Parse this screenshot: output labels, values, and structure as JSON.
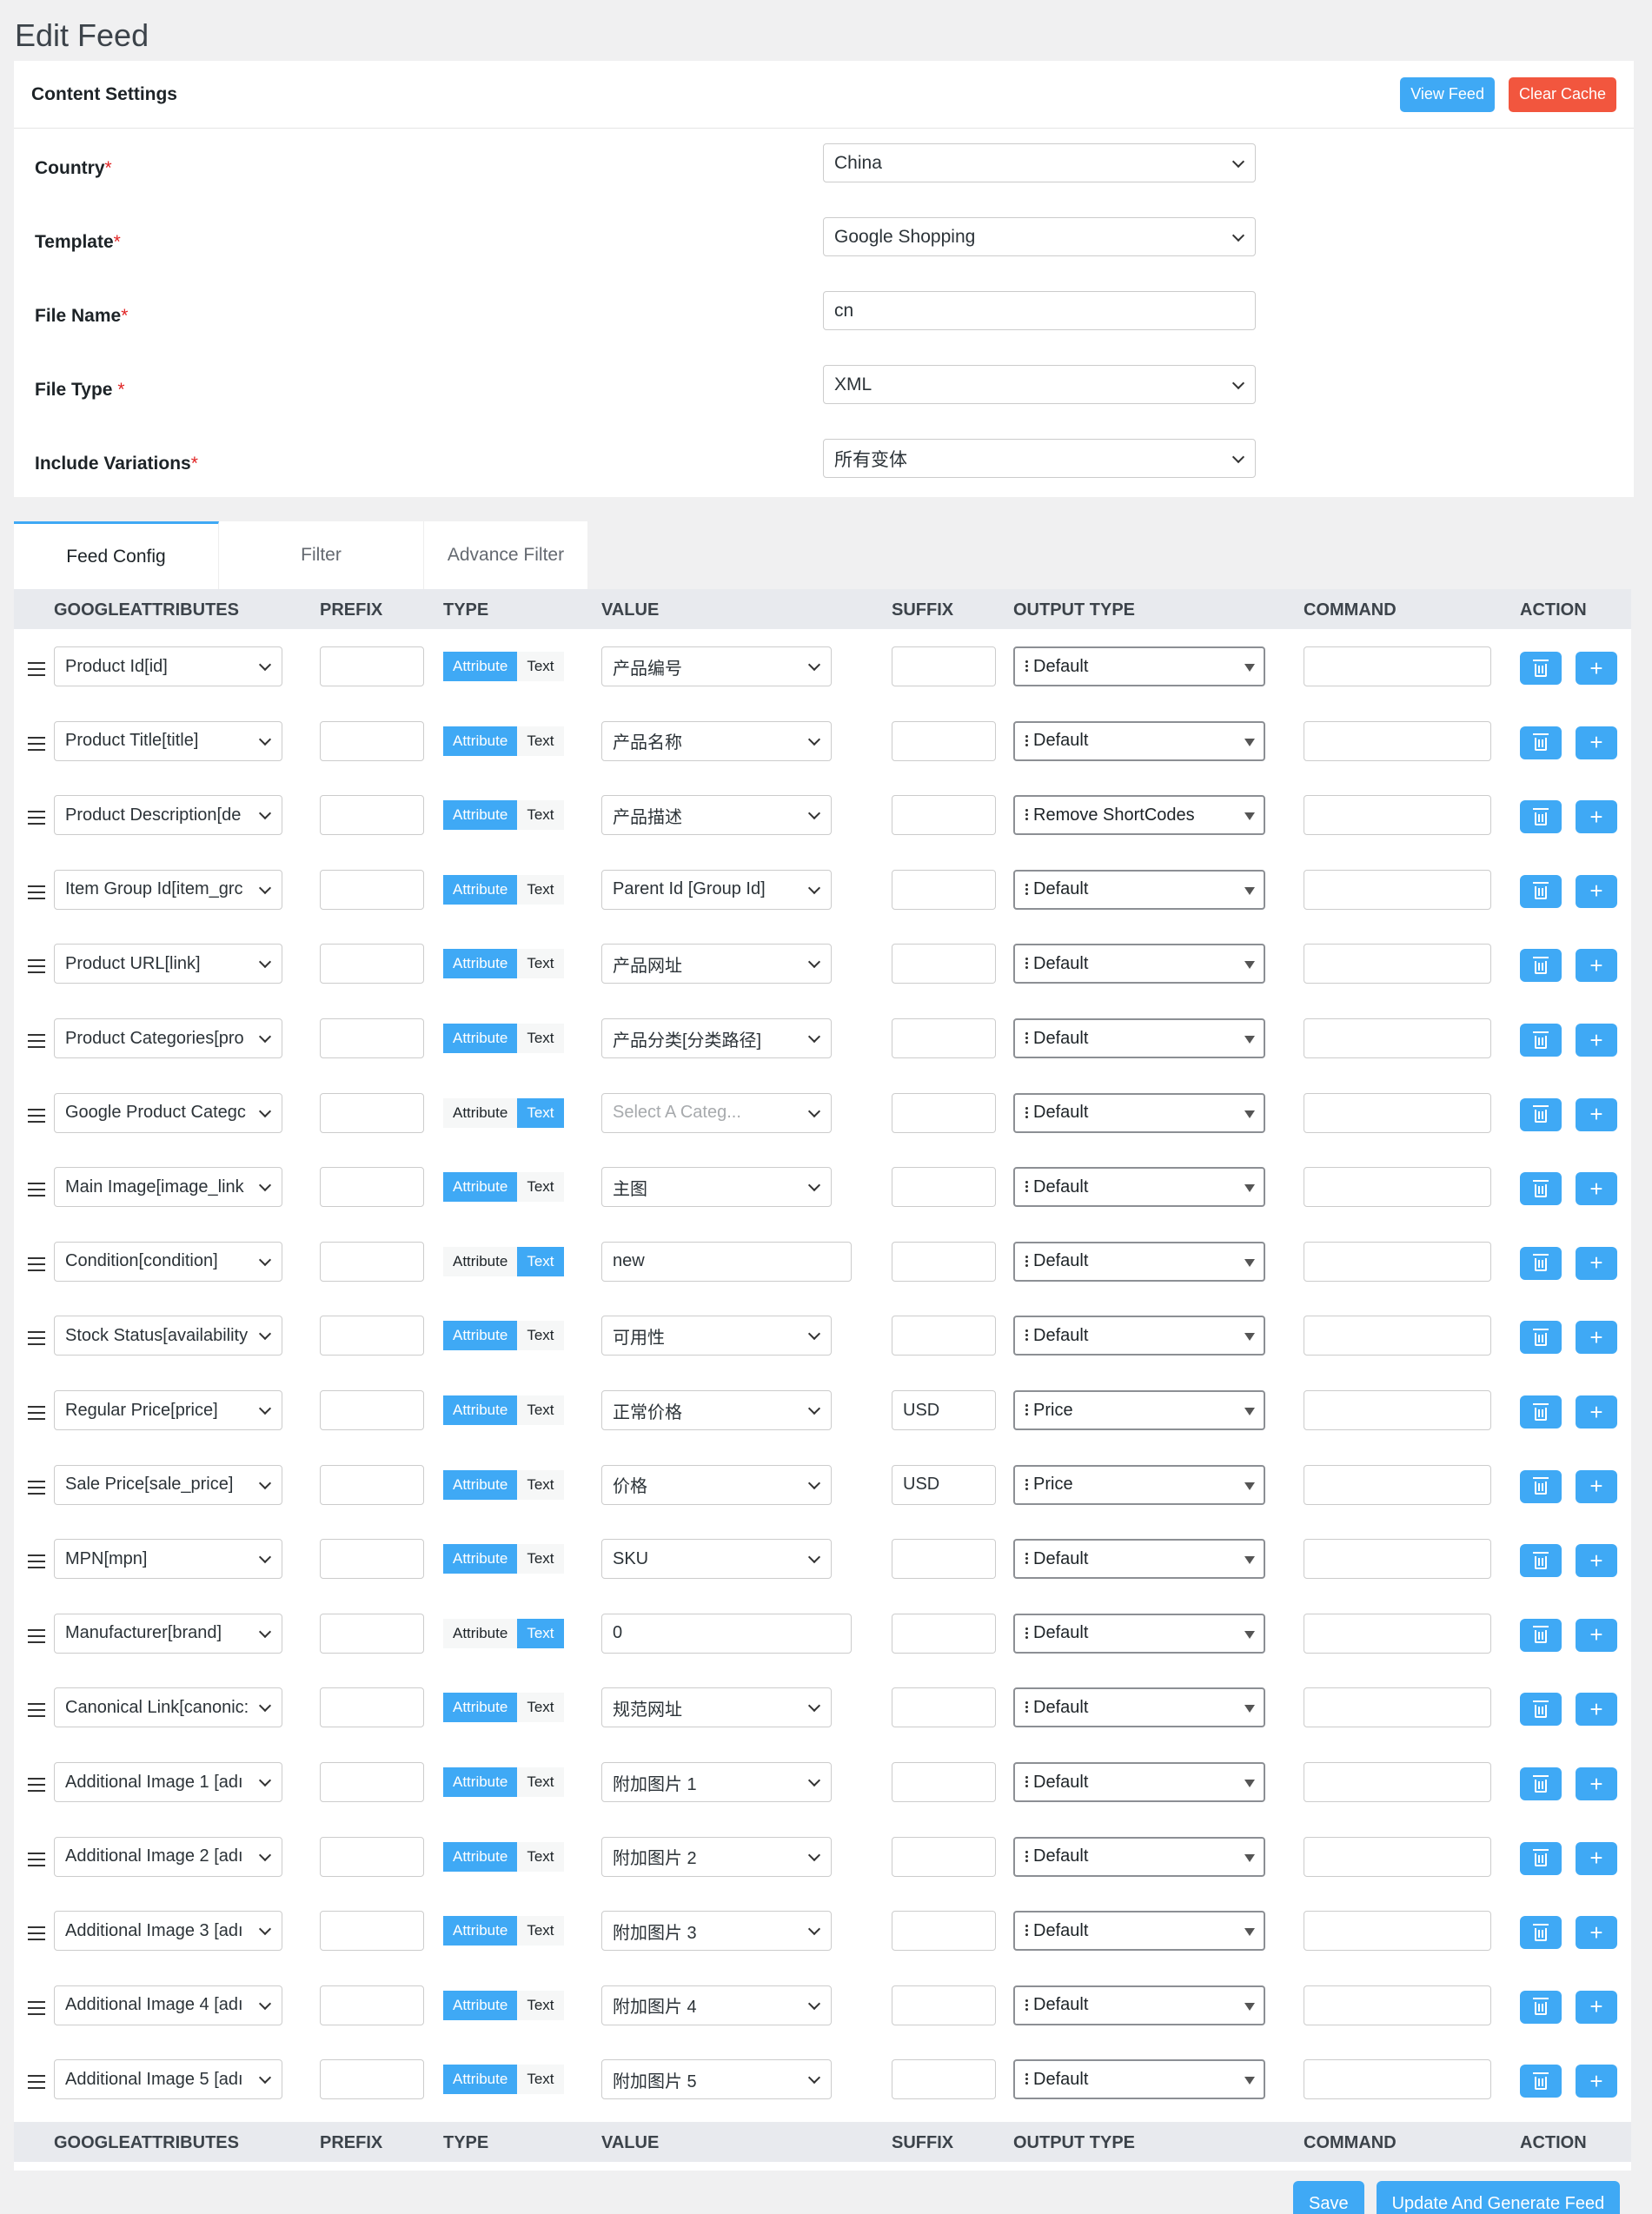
{
  "page": {
    "title": "Edit Feed"
  },
  "content_settings": {
    "title": "Content Settings",
    "view_feed": "View Feed",
    "clear_cache": "Clear Cache",
    "fields": [
      {
        "label": "Country",
        "required": "*",
        "value": "China",
        "kind": "select"
      },
      {
        "label": "Template",
        "required": "*",
        "value": "Google Shopping",
        "kind": "select"
      },
      {
        "label": "File Name",
        "required": "*",
        "value": "cn",
        "kind": "input"
      },
      {
        "label": "File Type ",
        "required": "*",
        "value": "XML",
        "kind": "select"
      },
      {
        "label": "Include Variations",
        "required": "*",
        "value": "所有变体",
        "kind": "select"
      }
    ]
  },
  "tabs": [
    "Feed Config",
    "Filter",
    "Advance Filter"
  ],
  "table": {
    "columns": [
      "GOOGLEATTRIBUTES",
      "PREFIX",
      "TYPE",
      "VALUE",
      "SUFFIX",
      "OUTPUT TYPE",
      "COMMAND",
      "ACTION"
    ],
    "type_labels": {
      "attribute": "Attribute",
      "text": "Text"
    },
    "rows": [
      {
        "attribute": "Product Id[id]",
        "prefix": "",
        "type": "attribute",
        "value": "产品编号",
        "suffix": "",
        "output": "Default",
        "command": ""
      },
      {
        "attribute": "Product Title[title]",
        "prefix": "",
        "type": "attribute",
        "value": "产品名称",
        "suffix": "",
        "output": "Default",
        "command": ""
      },
      {
        "attribute": "Product Description[de",
        "prefix": "",
        "type": "attribute",
        "value": "产品描述",
        "suffix": "",
        "output": "Remove ShortCodes",
        "command": ""
      },
      {
        "attribute": "Item Group Id[item_grc",
        "prefix": "",
        "type": "attribute",
        "value": "Parent Id [Group Id]",
        "suffix": "",
        "output": "Default",
        "command": ""
      },
      {
        "attribute": "Product URL[link]",
        "prefix": "",
        "type": "attribute",
        "value": "产品网址",
        "suffix": "",
        "output": "Default",
        "command": ""
      },
      {
        "attribute": "Product Categories[pro",
        "prefix": "",
        "type": "attribute",
        "value": "产品分类[分类路径]",
        "suffix": "",
        "output": "Default",
        "command": ""
      },
      {
        "attribute": "Google Product Categc",
        "prefix": "",
        "type": "text",
        "value": "Select A Categ...",
        "value_kind": "placeholder",
        "suffix": "",
        "output": "Default",
        "command": ""
      },
      {
        "attribute": "Main Image[image_link",
        "prefix": "",
        "type": "attribute",
        "value": "主图",
        "suffix": "",
        "output": "Default",
        "command": ""
      },
      {
        "attribute": "Condition[condition]",
        "prefix": "",
        "type": "text",
        "value": "new",
        "value_kind": "input",
        "suffix": "",
        "output": "Default",
        "command": ""
      },
      {
        "attribute": "Stock Status[availability",
        "prefix": "",
        "type": "attribute",
        "value": "可用性",
        "suffix": "",
        "output": "Default",
        "command": ""
      },
      {
        "attribute": "Regular Price[price]",
        "prefix": "",
        "type": "attribute",
        "value": "正常价格",
        "suffix": "USD",
        "output": "Price",
        "command": ""
      },
      {
        "attribute": "Sale Price[sale_price]",
        "prefix": "",
        "type": "attribute",
        "value": "价格",
        "suffix": "USD",
        "output": "Price",
        "command": ""
      },
      {
        "attribute": "MPN[mpn]",
        "prefix": "",
        "type": "attribute",
        "value": "SKU",
        "suffix": "",
        "output": "Default",
        "command": ""
      },
      {
        "attribute": "Manufacturer[brand]",
        "prefix": "",
        "type": "text",
        "value": "0",
        "value_kind": "input",
        "suffix": "",
        "output": "Default",
        "command": ""
      },
      {
        "attribute": "Canonical Link[canonic:",
        "prefix": "",
        "type": "attribute",
        "value": "规范网址",
        "suffix": "",
        "output": "Default",
        "command": ""
      },
      {
        "attribute": "Additional Image 1 [adı",
        "prefix": "",
        "type": "attribute",
        "value": "附加图片 1",
        "suffix": "",
        "output": "Default",
        "command": ""
      },
      {
        "attribute": "Additional Image 2 [adı",
        "prefix": "",
        "type": "attribute",
        "value": "附加图片 2",
        "suffix": "",
        "output": "Default",
        "command": ""
      },
      {
        "attribute": "Additional Image 3 [adı",
        "prefix": "",
        "type": "attribute",
        "value": "附加图片 3",
        "suffix": "",
        "output": "Default",
        "command": ""
      },
      {
        "attribute": "Additional Image 4 [adı",
        "prefix": "",
        "type": "attribute",
        "value": "附加图片 4",
        "suffix": "",
        "output": "Default",
        "command": ""
      },
      {
        "attribute": "Additional Image 5 [adı",
        "prefix": "",
        "type": "attribute",
        "value": "附加图片 5",
        "suffix": "",
        "output": "Default",
        "command": ""
      }
    ]
  },
  "footer_buttons": {
    "save": "Save",
    "update": "Update And Generate Feed"
  },
  "icons": {
    "drag": "drag-handle-icon",
    "delete": "trash-icon",
    "add": "plus-icon",
    "dropdown": "chevron-down-icon"
  },
  "colors": {
    "accent": "#3fa9f5",
    "danger": "#f2563e"
  }
}
